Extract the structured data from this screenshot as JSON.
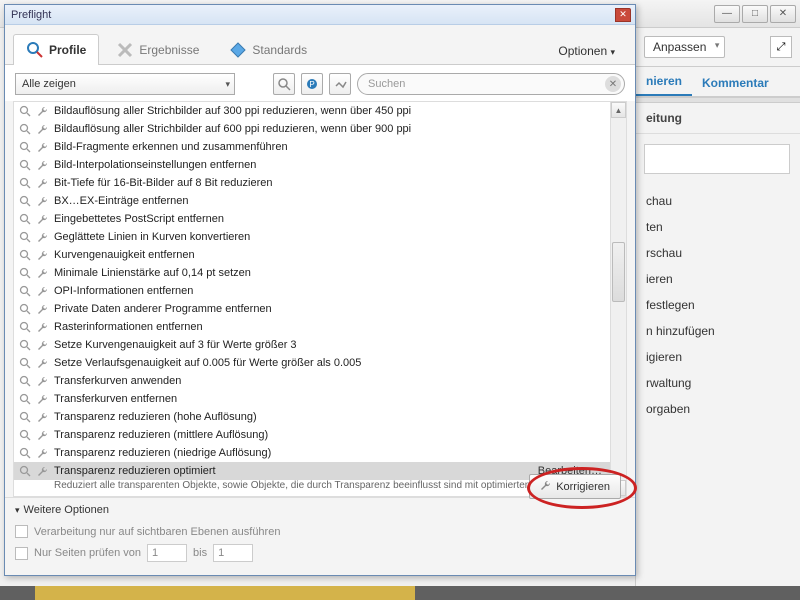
{
  "bg": {
    "min": "—",
    "max": "□",
    "close": "✕"
  },
  "rightpane": {
    "dropdown": "Anpassen",
    "tab_truncated": "nieren",
    "tab_kommentar": "Kommentar",
    "heading_truncated": "eitung",
    "items": [
      "chau",
      "ten",
      "rschau",
      "ieren",
      "festlegen",
      "n hinzufügen",
      "igieren",
      "rwaltung",
      "orgaben"
    ]
  },
  "dialog": {
    "title": "Preflight",
    "tabs": {
      "profile": "Profile",
      "ergebnisse": "Ergebnisse",
      "standards": "Standards"
    },
    "options": "Optionen",
    "dropdown": "Alle zeigen",
    "search_placeholder": "Suchen",
    "bearbeiten": "Bearbeiten…",
    "items": [
      "Bildauflösung aller Strichbilder auf 300 ppi reduzieren, wenn über 450 ppi",
      "Bildauflösung aller Strichbilder auf 600 ppi reduzieren, wenn über 900 ppi",
      "Bild-Fragmente erkennen und zusammenführen",
      "Bild-Interpolationseinstellungen entfernen",
      "Bit-Tiefe für 16-Bit-Bilder auf 8 Bit reduzieren",
      "BX…EX-Einträge entfernen",
      "Eingebettetes PostScript entfernen",
      "Geglättete Linien in Kurven konvertieren",
      "Kurvengenauigkeit entfernen",
      "Minimale Linienstärke auf 0,14 pt setzen",
      "OPI-Informationen entfernen",
      "Private Daten anderer Programme entfernen",
      "Rasterinformationen entfernen",
      "Setze Kurvengenauigkeit auf 3 für Werte größer 3",
      "Setze Verlaufsgenauigkeit auf 0.005 für Werte größer als 0.005",
      "Transferkurven anwenden",
      "Transferkurven entfernen",
      "Transparenz reduzieren (hohe Auflösung)",
      "Transparenz reduzieren (mittlere Auflösung)",
      "Transparenz reduzieren (niedrige Auflösung)",
      "Transparenz reduzieren optimiert"
    ],
    "desc_truncated": "Reduziert alle transparenten Objekte, sowie Objekte, die durch Transparenz beeinflusst sind mit optimierten",
    "weitere": "Weitere Optionen",
    "korrigieren": "Korrigieren",
    "check1": "Verarbeitung nur auf sichtbaren Ebenen ausführen",
    "check2_a": "Nur Seiten prüfen von",
    "check2_b": "bis",
    "page_from": "1",
    "page_to": "1"
  }
}
